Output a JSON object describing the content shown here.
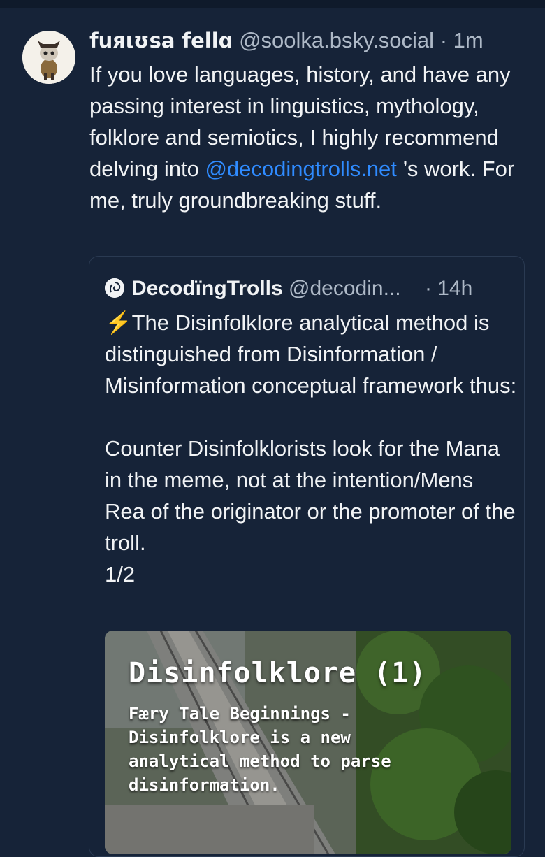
{
  "post": {
    "author_name": "fuяιʊsa fellɑ",
    "author_handle": "@soolka.bsky.social",
    "separator": "·",
    "time": "1m",
    "text_before_mention": "If you love languages, history, and have any passing interest in linguistics, mythology, folklore and semiotics, I highly recommend delving into ",
    "mention": "@decodingtrolls.net",
    "text_after_mention": " ’s work. For me, truly groundbreaking stuff.",
    "avatar_icon": "cat-avatar-icon"
  },
  "quote": {
    "avatar_icon": "spiral-avatar-icon",
    "author_name": "DecodïngTrolls",
    "author_handle": "@decodin...",
    "time": "· 14h",
    "bolt": "⚡",
    "text": "The Disinfolklore analytical method is  distinguished from Disinformation / Misinformation conceptual framework thus:\n\nCounter Disinfolklorists look for the Mana in the meme, not at the intention/Mens Rea of the originator or the promoter of the troll.\n1/2",
    "media": {
      "title": "Disinfolklore (1)",
      "subtitle": "Færy Tale Beginnings -\nDisinfolklore is a new\nanalytical method to parse\ndisinformation."
    }
  },
  "colors": {
    "background": "#162338",
    "text": "#f1f3f5",
    "muted": "#aeb9c7",
    "mention": "#2f8bff"
  }
}
